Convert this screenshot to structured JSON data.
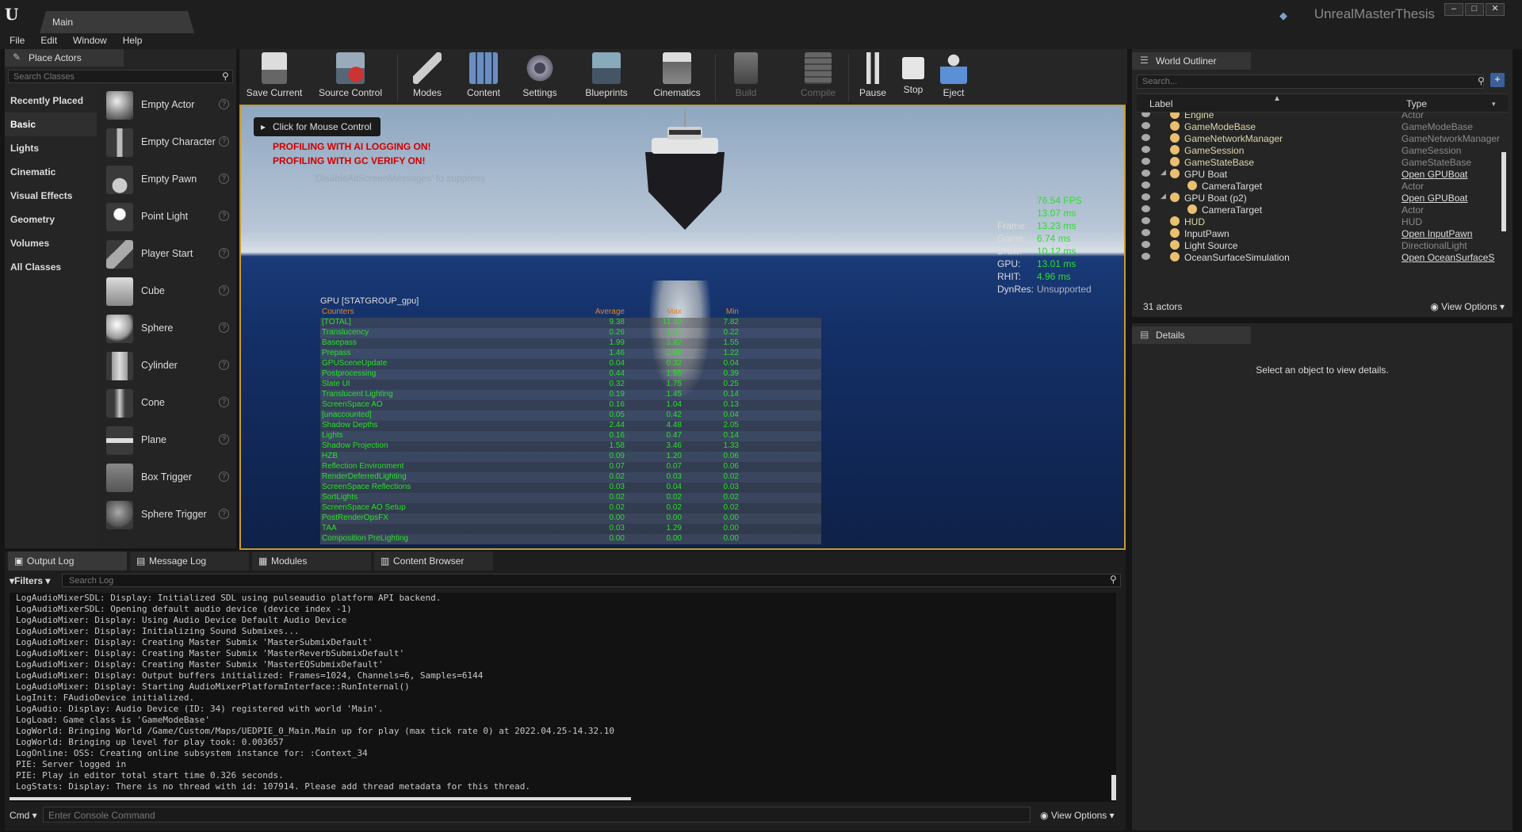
{
  "window": {
    "tab": "Main",
    "project": "UnrealMasterThesis"
  },
  "menu": [
    "File",
    "Edit",
    "Window",
    "Help"
  ],
  "place_actors": {
    "tab": "Place Actors",
    "search_placeholder": "Search Classes",
    "categories": [
      "Recently Placed",
      "Basic",
      "Lights",
      "Cinematic",
      "Visual Effects",
      "Geometry",
      "Volumes",
      "All Classes"
    ],
    "selected_category": "Basic",
    "items": [
      "Empty Actor",
      "Empty Character",
      "Empty Pawn",
      "Point Light",
      "Player Start",
      "Cube",
      "Sphere",
      "Cylinder",
      "Cone",
      "Plane",
      "Box Trigger",
      "Sphere Trigger"
    ]
  },
  "toolbar": {
    "save": "Save Current",
    "source": "Source Control",
    "modes": "Modes",
    "content": "Content",
    "settings": "Settings",
    "blueprints": "Blueprints",
    "cinematics": "Cinematics",
    "build": "Build",
    "compile": "Compile",
    "pause": "Pause",
    "stop": "Stop",
    "eject": "Eject"
  },
  "viewport": {
    "click_mouse": "Click for Mouse Control",
    "msg1": "PROFILING WITH AI LOGGING ON!",
    "msg2": "PROFILING WITH GC VERIFY ON!",
    "suppress": "'DisableAllScreenMessages' to suppress",
    "fps": "76.54 FPS",
    "frame_ms": "13.07 ms",
    "stats": [
      [
        "Frame:",
        "13.23 ms"
      ],
      [
        "Game:",
        "6.74 ms"
      ],
      [
        "Draw:",
        "10.12 ms"
      ],
      [
        "GPU:",
        "13.01 ms"
      ],
      [
        "RHIT:",
        "4.96 ms"
      ]
    ],
    "dynres_k": "DynRes:",
    "dynres_v": "Unsupported",
    "gpu_title": "GPU [STATGROUP_gpu]",
    "gpu_head": [
      "Counters",
      "Average",
      "Max",
      "Min"
    ],
    "gpu_rows": [
      [
        "[TOTAL]",
        "9.38",
        "11.10",
        "7.82"
      ],
      [
        "Translucency",
        "0.26",
        "1.37",
        "0.22"
      ],
      [
        "Basepass",
        "1.99",
        "3.82",
        "1.55"
      ],
      [
        "Prepass",
        "1.46",
        "2.80",
        "1.22"
      ],
      [
        "GPUSceneUpdate",
        "0.04",
        "0.32",
        "0.04"
      ],
      [
        "Postprocessing",
        "0.44",
        "1.55",
        "0.39"
      ],
      [
        "Slate UI",
        "0.32",
        "1.75",
        "0.25"
      ],
      [
        "Translucent Lighting",
        "0.19",
        "1.45",
        "0.14"
      ],
      [
        "ScreenSpace AO",
        "0.16",
        "1.04",
        "0.13"
      ],
      [
        "[unaccounted]",
        "0.05",
        "0.42",
        "0.04"
      ],
      [
        "Shadow Depths",
        "2.44",
        "4.48",
        "2.05"
      ],
      [
        "Lights",
        "0.16",
        "0.47",
        "0.14"
      ],
      [
        "Shadow Projection",
        "1.58",
        "3.46",
        "1.33"
      ],
      [
        "HZB",
        "0.09",
        "1.20",
        "0.06"
      ],
      [
        "Reflection Environment",
        "0.07",
        "0.07",
        "0.06"
      ],
      [
        "RenderDeferredLighting",
        "0.02",
        "0.03",
        "0.02"
      ],
      [
        "ScreenSpace Reflections",
        "0.03",
        "0.04",
        "0.03"
      ],
      [
        "SortLights",
        "0.02",
        "0.02",
        "0.02"
      ],
      [
        "ScreenSpace AO Setup",
        "0.02",
        "0.02",
        "0.02"
      ],
      [
        "PostRenderOpsFX",
        "0.00",
        "0.00",
        "0.00"
      ],
      [
        "TAA",
        "0.03",
        "1.29",
        "0.00"
      ],
      [
        "Composition PreLighting",
        "0.00",
        "0.00",
        "0.00"
      ]
    ]
  },
  "outliner": {
    "tab": "World Outliner",
    "search_placeholder": "Search...",
    "col_label": "Label",
    "col_type": "Type",
    "rows": [
      {
        "label": "Engine",
        "type": "Actor",
        "indent": 0
      },
      {
        "label": "GameModeBase",
        "type": "GameModeBase",
        "indent": 0
      },
      {
        "label": "GameNetworkManager",
        "type": "GameNetworkManager",
        "indent": 0
      },
      {
        "label": "GameSession",
        "type": "GameSession",
        "indent": 0
      },
      {
        "label": "GameStateBase",
        "type": "GameStateBase",
        "indent": 0
      },
      {
        "label": "GPU Boat",
        "type": "Open GPUBoat",
        "indent": 0,
        "white": true,
        "link": true,
        "expand": true
      },
      {
        "label": "CameraTarget",
        "type": "Actor",
        "indent": 1,
        "white": true
      },
      {
        "label": "GPU Boat (p2)",
        "type": "Open GPUBoat",
        "indent": 0,
        "white": true,
        "link": true,
        "expand": true
      },
      {
        "label": "CameraTarget",
        "type": "Actor",
        "indent": 1,
        "white": true
      },
      {
        "label": "HUD",
        "type": "HUD",
        "indent": 0
      },
      {
        "label": "InputPawn",
        "type": "Open InputPawn",
        "indent": 0,
        "white": true,
        "link": true
      },
      {
        "label": "Light Source",
        "type": "DirectionalLight",
        "indent": 0,
        "white": true
      },
      {
        "label": "OceanSurfaceSimulation",
        "type": "Open OceanSurfaceS",
        "indent": 0,
        "white": true,
        "link": true
      }
    ],
    "count": "31 actors",
    "view_options": "View Options"
  },
  "details": {
    "tab": "Details",
    "message": "Select an object to view details."
  },
  "bottom": {
    "tabs": [
      "Output Log",
      "Message Log",
      "Modules",
      "Content Browser"
    ],
    "filters": "Filters",
    "search_placeholder": "Search Log",
    "log": [
      "LogAudioMixerSDL: Display: Initialized SDL using pulseaudio platform API backend.",
      "LogAudioMixerSDL: Opening default audio device (device index -1)",
      "LogAudioMixer: Display: Using Audio Device Default Audio Device",
      "LogAudioMixer: Display: Initializing Sound Submixes...",
      "LogAudioMixer: Display: Creating Master Submix 'MasterSubmixDefault'",
      "LogAudioMixer: Display: Creating Master Submix 'MasterReverbSubmixDefault'",
      "LogAudioMixer: Display: Creating Master Submix 'MasterEQSubmixDefault'",
      "LogAudioMixer: Display: Output buffers initialized: Frames=1024, Channels=6, Samples=6144",
      "LogAudioMixer: Display: Starting AudioMixerPlatformInterface::RunInternal()",
      "LogInit: FAudioDevice initialized.",
      "LogAudio: Display: Audio Device (ID: 34) registered with world 'Main'.",
      "LogLoad: Game class is 'GameModeBase'",
      "LogWorld: Bringing World /Game/Custom/Maps/UEDPIE_0_Main.Main up for play (max tick rate 0) at 2022.04.25-14.32.10",
      "LogWorld: Bringing up level for play took: 0.003657",
      "LogOnline: OSS: Creating online subsystem instance for: :Context_34",
      "PIE: Server logged in",
      "PIE: Play in editor total start time 0.326 seconds.",
      "LogStats: Display: There is no thread with id: 107914. Please add thread metadata for this thread."
    ],
    "cmd": "Cmd",
    "cmd_placeholder": "Enter Console Command",
    "view_options": "View Options"
  }
}
